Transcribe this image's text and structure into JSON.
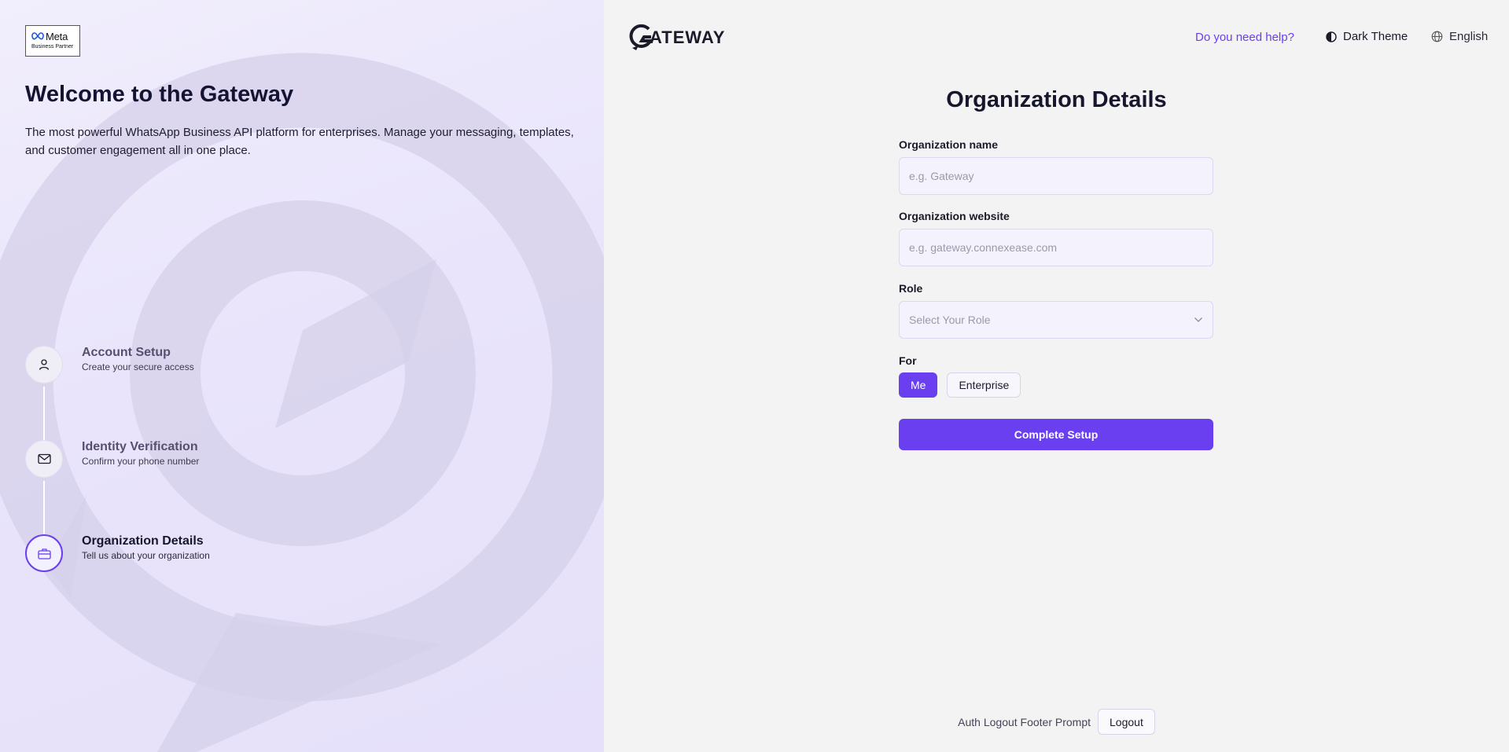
{
  "left_panel": {
    "partner_badge": {
      "brand": "Meta",
      "subtitle": "Business Partner"
    },
    "welcome_title": "Welcome to the Gateway",
    "welcome_description": "The most powerful WhatsApp Business API platform for enterprises. Manage your messaging, templates, and customer engagement all in one place.",
    "steps": [
      {
        "title": "Account Setup",
        "subtitle": "Create your secure access",
        "icon": "user-icon",
        "state": "completed"
      },
      {
        "title": "Identity Verification",
        "subtitle": "Confirm your phone number",
        "icon": "mail-icon",
        "state": "completed"
      },
      {
        "title": "Organization Details",
        "subtitle": "Tell us about your organization",
        "icon": "briefcase-icon",
        "state": "active"
      }
    ]
  },
  "header": {
    "brand": "ATEWAY",
    "help_link": "Do you need help?",
    "theme_toggle": "Dark Theme",
    "language": "English"
  },
  "form": {
    "title": "Organization Details",
    "org_name": {
      "label": "Organization name",
      "placeholder": "e.g. Gateway",
      "value": ""
    },
    "org_website": {
      "label": "Organization website",
      "placeholder": "e.g. gateway.connexease.com",
      "value": ""
    },
    "role": {
      "label": "Role",
      "placeholder": "Select Your Role"
    },
    "for": {
      "label": "For",
      "options": [
        "Me",
        "Enterprise"
      ],
      "selected": "Me"
    },
    "submit_label": "Complete Setup"
  },
  "footer": {
    "prompt": "Auth Logout Footer Prompt",
    "logout_label": "Logout"
  },
  "colors": {
    "accent": "#6a3ff0",
    "left_panel_bg": "#e9e4fb",
    "right_panel_bg": "#f3f3f3"
  }
}
